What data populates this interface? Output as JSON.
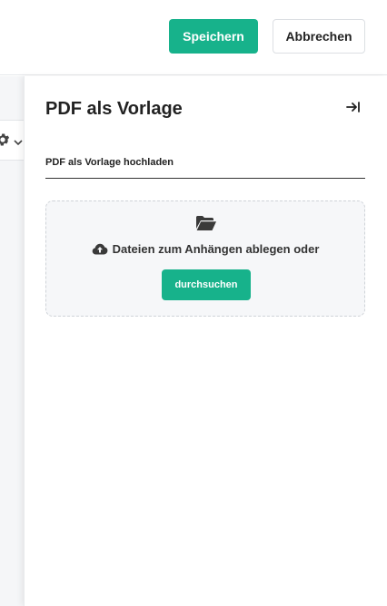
{
  "toolbar": {
    "save_label": "Speichern",
    "cancel_label": "Abbrechen"
  },
  "panel": {
    "title": "PDF als Vorlage",
    "collapse_icon": "collapse-right-icon",
    "section_label": "PDF als Vorlage hochladen",
    "dropzone": {
      "folder_icon": "folder-open-icon",
      "cloud_icon": "cloud-upload-icon",
      "text": "Dateien zum Anhängen ablegen oder",
      "browse_label": "durchsuchen"
    }
  },
  "background": {
    "settings_icon": "gear-icon",
    "dropdown_icon": "chevron-down-icon"
  },
  "colors": {
    "accent": "#17b28b",
    "dropzone_bg": "#f6f7f9",
    "page_bg": "#f5f6f8"
  }
}
